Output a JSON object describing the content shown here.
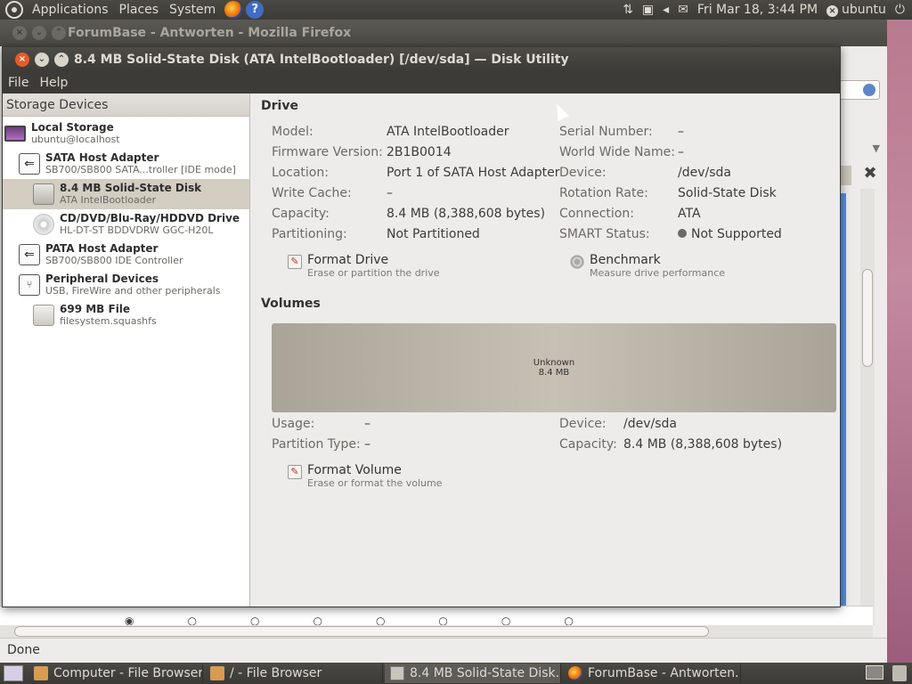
{
  "top_panel": {
    "menus": [
      "Applications",
      "Places",
      "System"
    ],
    "clock": "Fri Mar 18,  3:44 PM",
    "user": "ubuntu"
  },
  "firefox": {
    "title": "ForumBase - Antworten - Mozilla Firefox",
    "status": "Done"
  },
  "disk_utility": {
    "title": "8.4 MB Solid-State Disk (ATA IntelBootloader) [/dev/sda] — Disk Utility",
    "menu": [
      "File",
      "Help"
    ],
    "sidebar": {
      "header": "Storage Devices",
      "items": [
        {
          "title": "Local Storage",
          "subtitle": "ubuntu@localhost",
          "icon": "computer-icon"
        },
        {
          "title": "SATA Host Adapter",
          "subtitle": "SB700/SB800 SATA...troller [IDE mode]",
          "icon": "host-adapter-icon"
        },
        {
          "title": "8.4 MB Solid-State Disk",
          "subtitle": "ATA IntelBootloader",
          "icon": "disk-icon",
          "selected": true
        },
        {
          "title": "CD/DVD/Blu-Ray/HDDVD Drive",
          "subtitle": "HL-DT-ST BDDVDRW GGC-H20L",
          "icon": "optical-drive-icon"
        },
        {
          "title": "PATA Host Adapter",
          "subtitle": "SB700/SB800 IDE Controller",
          "icon": "host-adapter-icon"
        },
        {
          "title": "Peripheral Devices",
          "subtitle": "USB, FireWire and other peripherals",
          "icon": "usb-icon"
        },
        {
          "title": "699 MB File",
          "subtitle": "filesystem.squashfs",
          "icon": "file-icon"
        }
      ]
    },
    "drive": {
      "heading": "Drive",
      "left": [
        {
          "label": "Model:",
          "value": "ATA IntelBootloader"
        },
        {
          "label": "Firmware Version:",
          "value": "2B1B0014"
        },
        {
          "label": "Location:",
          "value": "Port 1 of SATA Host Adapter"
        },
        {
          "label": "Write Cache:",
          "value": "–"
        },
        {
          "label": "Capacity:",
          "value": "8.4 MB (8,388,608 bytes)"
        },
        {
          "label": "Partitioning:",
          "value": "Not Partitioned"
        }
      ],
      "right": [
        {
          "label": "Serial Number:",
          "value": "–"
        },
        {
          "label": "World Wide Name:",
          "value": "–"
        },
        {
          "label": "Device:",
          "value": "/dev/sda"
        },
        {
          "label": "Rotation Rate:",
          "value": "Solid-State Disk"
        },
        {
          "label": "Connection:",
          "value": "ATA"
        },
        {
          "label": "SMART Status:",
          "value": "Not Supported"
        }
      ],
      "actions": [
        {
          "title": "Format Drive",
          "subtitle": "Erase or partition the drive"
        },
        {
          "title": "Benchmark",
          "subtitle": "Measure drive performance"
        }
      ]
    },
    "volumes": {
      "heading": "Volumes",
      "bar_label": "Unknown",
      "bar_size": "8.4 MB",
      "left": [
        {
          "label": "Usage:",
          "value": "–"
        },
        {
          "label": "Partition Type:",
          "value": "–"
        }
      ],
      "right": [
        {
          "label": "Device:",
          "value": "/dev/sda"
        },
        {
          "label": "Capacity:",
          "value": "8.4 MB (8,388,608 bytes)"
        }
      ],
      "action": {
        "title": "Format Volume",
        "subtitle": "Erase or format the volume"
      }
    }
  },
  "taskbar": [
    {
      "label": "Computer - File Browser",
      "icon": "folder-icon"
    },
    {
      "label": "/ - File Browser",
      "icon": "folder-icon"
    },
    {
      "label": "8.4 MB Solid-State Disk...",
      "icon": "disk-icon",
      "active": true
    },
    {
      "label": "ForumBase - Antworten...",
      "icon": "firefox-icon"
    }
  ]
}
